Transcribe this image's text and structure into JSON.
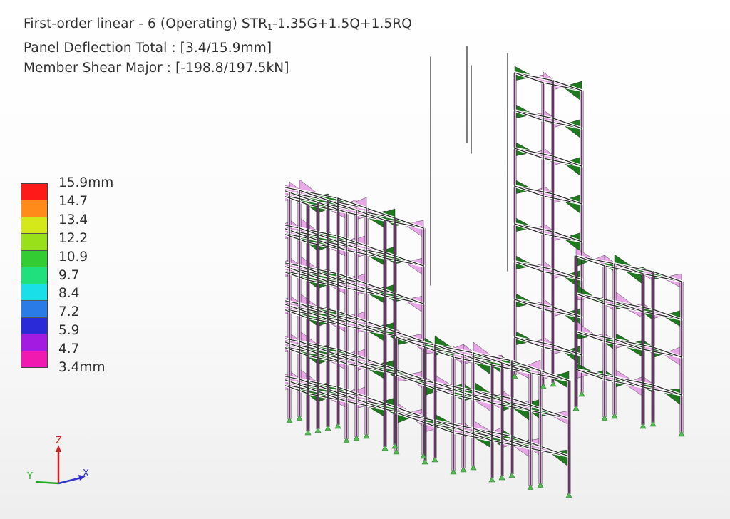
{
  "header": {
    "title_prefix": "First-order linear - 6 (Operating) STR",
    "title_subscript": "1",
    "title_suffix": "-1.35G+1.5Q+1.5RQ",
    "panel_deflection": "Panel Deflection Total : [3.4/15.9mm]",
    "member_shear": "Member Shear Major : [-198.8/197.5kN]"
  },
  "legend": {
    "labels": [
      "15.9mm",
      "14.7",
      "13.4",
      "12.2",
      "10.9",
      "9.7",
      "8.4",
      "7.2",
      "5.9",
      "4.7",
      "3.4mm"
    ],
    "colors": [
      "#ff1a1a",
      "#ff8c1a",
      "#d4e81a",
      "#99e01a",
      "#33cc33",
      "#1fe07a",
      "#1adfe8",
      "#2a7ae8",
      "#2a2ad8",
      "#a31ae0",
      "#f01ab0"
    ]
  },
  "model": {
    "frame_color": "#2b2b2b",
    "support_color": "#55bb55",
    "shear_positive_color": "#1f7a1f",
    "shear_negative_color": "#e8a8e8"
  },
  "axes": {
    "x_label": "X",
    "y_label": "Y",
    "z_label": "Z",
    "x_color": "#3333cc",
    "y_color": "#22aa22",
    "z_color": "#cc2222"
  }
}
